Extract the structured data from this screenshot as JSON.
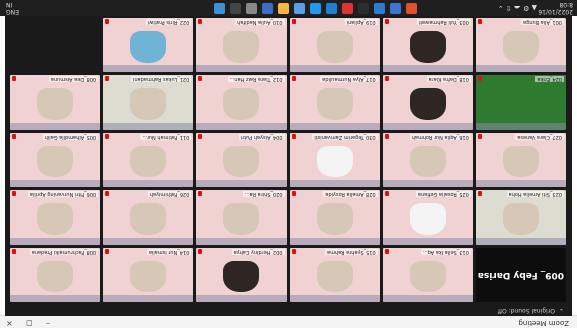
{
  "window": {
    "title": "Zoom Meeting",
    "controls": [
      "×",
      "◻",
      "–"
    ]
  },
  "meeting": {
    "original_sound": "Original Sound: Off"
  },
  "featured": {
    "name": "009_ Feby Darisa"
  },
  "tiles": [
    {
      "name": "013_Sella Ika Aq...",
      "kind": "light"
    },
    {
      "name": "015_Syahra Rahma",
      "kind": "light"
    },
    {
      "name": "002_Herdiny Cahya",
      "kind": "dark"
    },
    {
      "name": "014_Nur Ismalia",
      "kind": "light"
    },
    {
      "name": "",
      "kind": "black"
    },
    {
      "name": "008_Fachrumaiki Pradana",
      "kind": "light"
    },
    {
      "name": "023_Siti Amelia Hoha",
      "kind": "room"
    },
    {
      "name": "025_Rosalia Gefiana",
      "kind": "white"
    },
    {
      "name": "028_Amalia Rosyida",
      "kind": "light"
    },
    {
      "name": "020_Shira Ra...",
      "kind": "light"
    },
    {
      "name": "026_Fathimiyah",
      "kind": "light"
    },
    {
      "name": "006_Fitri Nurvaning Aprilia",
      "kind": "light"
    },
    {
      "name": "027_Clara Vanesa",
      "kind": "light"
    },
    {
      "name": "016_Aqila Nur Rohmah",
      "kind": "light"
    },
    {
      "name": "030_Tegarim Zamvanisti",
      "kind": "white"
    },
    {
      "name": "004_Aisyah Putri",
      "kind": "light"
    },
    {
      "name": "011_Fatimah Nur...",
      "kind": "light"
    },
    {
      "name": "005_Alhamdila Galih",
      "kind": "light"
    },
    {
      "name": "024_Erika",
      "kind": "green"
    },
    {
      "name": "018_Dafra Kiara",
      "kind": "dark"
    },
    {
      "name": "017_Alya Nurmaulida",
      "kind": "light"
    },
    {
      "name": "012_Tiara Raiz Han...",
      "kind": "light"
    },
    {
      "name": "021_Lukas Rahmadani",
      "kind": "room"
    },
    {
      "name": "008_Dea Aismuna",
      "kind": "light"
    },
    {
      "name": "001_Alia Bunga",
      "kind": "light"
    },
    {
      "name": "003_Yuli Rahmawati",
      "kind": "dark"
    },
    {
      "name": "019_Apliani",
      "kind": "light"
    },
    {
      "name": "010_Aulia Nadifah",
      "kind": "light"
    },
    {
      "name": "022_Riris Pratiwi",
      "kind": "blue"
    }
  ],
  "taskbar": {
    "date": "2022/10/16",
    "time": "8:08",
    "right_top": "ENG",
    "right_bottom": "IN",
    "app_colors": [
      "#e2502b",
      "#3b73d9",
      "#2a7bd1",
      "#2d2d2d",
      "#d33",
      "#1e7fd4",
      "#2196f3",
      "#5aa0e6",
      "#f6b73c",
      "#3a6cc7",
      "#888",
      "#444",
      "#3d8fd6"
    ]
  }
}
